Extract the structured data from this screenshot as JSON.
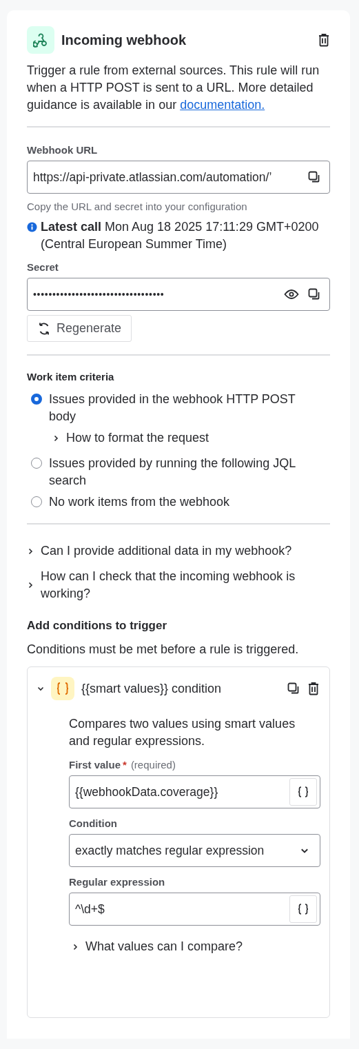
{
  "header": {
    "title": "Incoming webhook"
  },
  "description": {
    "text": "Trigger a rule from external sources. This rule will run when a HTTP POST is sent to a URL. More detailed guidance is available in our",
    "link": "documentation."
  },
  "webhook_url": {
    "label": "Webhook URL",
    "value": "https://api-private.atlassian.com/automation/’",
    "helper": "Copy the URL and secret into your configuration"
  },
  "latest_call": {
    "label": "Latest call",
    "text": "Mon Aug 18 2025 17:11:29 GMT+0200 (Central European Summer Time)"
  },
  "secret": {
    "label": "Secret",
    "value": "••••••••••••••••••••••••••••••••••",
    "button": "Regenerate"
  },
  "work_item_criteria": {
    "title": "Work item criteria",
    "options": [
      {
        "label": "Issues provided in the webhook HTTP POST body",
        "selected": true,
        "expander": {
          "label": "How to format the request",
          "expanded": false
        }
      },
      {
        "label": "Issues provided by running the following JQL search",
        "selected": false
      },
      {
        "label": "No work items from the webhook",
        "selected": false
      }
    ]
  },
  "faq": [
    {
      "label": "Can I provide additional data in my webhook?",
      "expanded": false
    },
    {
      "label": "How can I check that the incoming webhook is working?",
      "expanded": false
    }
  ],
  "conditions": {
    "title": "Add conditions to trigger",
    "description": "Conditions must be met before a rule is triggered.",
    "items": [
      {
        "title": "{{smart values}} condition",
        "expanded": true,
        "description": "Compares two values using smart values and regular expressions.",
        "fields": [
          {
            "kind": "smart",
            "label": "First value",
            "required": true,
            "required_mark": "*",
            "required_note": "(required)",
            "value": "{{webhookData.coverage}}"
          },
          {
            "kind": "select",
            "label": "Condition",
            "value": "exactly matches regular expression"
          },
          {
            "kind": "smart",
            "label": "Regular expression",
            "value": "^\\d+$"
          }
        ],
        "help": {
          "label": "What values can I compare?",
          "expanded": false
        }
      }
    ]
  }
}
